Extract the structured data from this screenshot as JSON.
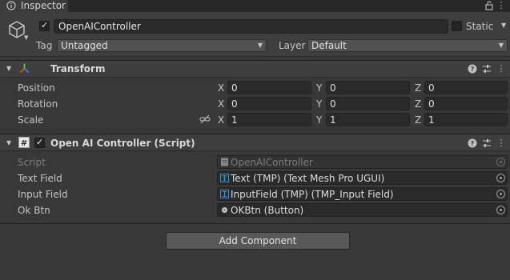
{
  "window": {
    "tab_title": "Inspector",
    "lock_icon": "lock-icon",
    "menu_icon": "kebab-menu-icon"
  },
  "header": {
    "active": true,
    "name": "OpenAIController",
    "static_label": "Static",
    "static_checked": false,
    "tag_label": "Tag",
    "tag_value": "Untagged",
    "layer_label": "Layer",
    "layer_value": "Default"
  },
  "transform": {
    "title": "Transform",
    "rows": [
      {
        "label": "Position",
        "x": "0",
        "y": "0",
        "z": "0"
      },
      {
        "label": "Rotation",
        "x": "0",
        "y": "0",
        "z": "0"
      },
      {
        "label": "Scale",
        "x": "1",
        "y": "1",
        "z": "1"
      }
    ],
    "axis": {
      "x": "X",
      "y": "Y",
      "z": "Z"
    }
  },
  "script_component": {
    "enabled": true,
    "title": "Open AI Controller (Script)",
    "fields": [
      {
        "label": "Script",
        "value": "OpenAIController",
        "icon": "script-asset-icon"
      },
      {
        "label": "Text Field",
        "value": "Text (TMP) (Text Mesh Pro UGUI)",
        "icon": "text-tmp-icon"
      },
      {
        "label": "Input Field",
        "value": "InputField (TMP) (TMP_Input Field)",
        "icon": "input-field-icon"
      },
      {
        "label": "Ok Btn",
        "value": "OKBtn (Button)",
        "icon": "button-icon"
      }
    ]
  },
  "add_component": "Add Component",
  "colors": {
    "background": "#383838",
    "field": "#2a2a2a",
    "transform_icon_x": "#d64a3b",
    "transform_icon_y": "#6fc33d",
    "transform_icon_z": "#3d7de0",
    "tmp_icon": "#3b8fe0"
  }
}
